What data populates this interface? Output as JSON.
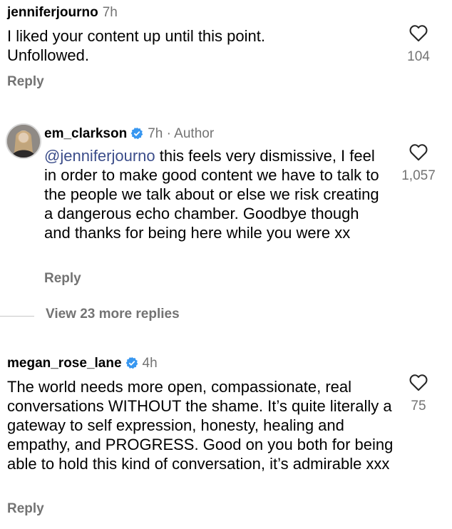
{
  "comments": [
    {
      "username": "jenniferjourno",
      "time": "7h",
      "body": "I liked your content up until this point. Unfollowed.",
      "likes": "104",
      "reply_label": "Reply"
    },
    {
      "username": "em_clarkson",
      "time": "7h",
      "separator": "·",
      "author_badge": "Author",
      "mention": "@jenniferjourno",
      "body": " this feels very dismissive, I feel in order to make good content we have to talk to the people we talk about or else we risk creating a dangerous echo chamber. Goodbye though and thanks for being here while you were xx",
      "likes": "1,057",
      "reply_label": "Reply",
      "verified": true
    },
    {
      "username": "megan_rose_lane",
      "time": "4h",
      "body": "The world needs more open, compassionate, real conversations WITHOUT the shame. It’s quite literally a gateway to self expression, honesty, healing and empathy, and PROGRESS. Good on you both for being able to hold this kind of conversation, it’s admirable xxx",
      "likes": "75",
      "reply_label": "Reply",
      "verified": true
    }
  ],
  "view_more_replies": "View 23 more replies",
  "colors": {
    "secondary_text": "#737373",
    "mention": "#3b4d8a",
    "verified_badge": "#3897f0"
  },
  "icons": {
    "like": "heart-outline-icon",
    "verified": "verified-badge-icon"
  }
}
